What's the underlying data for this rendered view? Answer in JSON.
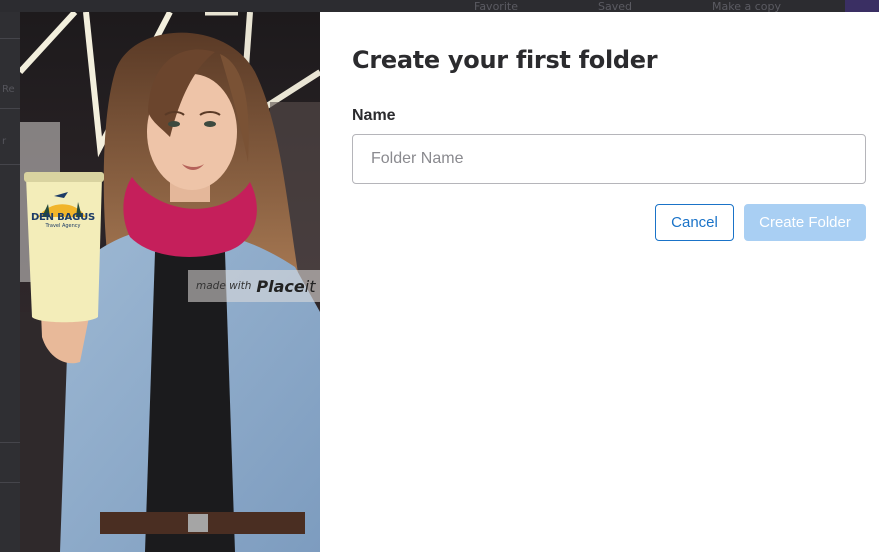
{
  "background": {
    "topbar_items": [
      "Favorite",
      "Saved",
      "Make a copy"
    ],
    "side_glyphs": [
      "Re",
      "r"
    ]
  },
  "modal": {
    "title": "Create your first folder",
    "name_label": "Name",
    "name_input": {
      "value": "",
      "placeholder": "Folder Name"
    },
    "cancel_label": "Cancel",
    "create_label": "Create Folder",
    "hero": {
      "badge_made": "made with",
      "badge_brand": "Place",
      "badge_brand_suffix": "it",
      "cup_name": "DEN BAGUS",
      "cup_sub": "Travel Agency"
    }
  },
  "colors": {
    "accent": "#1a73c8",
    "create_disabled": "#a9cff3",
    "title": "#2b2b2e"
  }
}
